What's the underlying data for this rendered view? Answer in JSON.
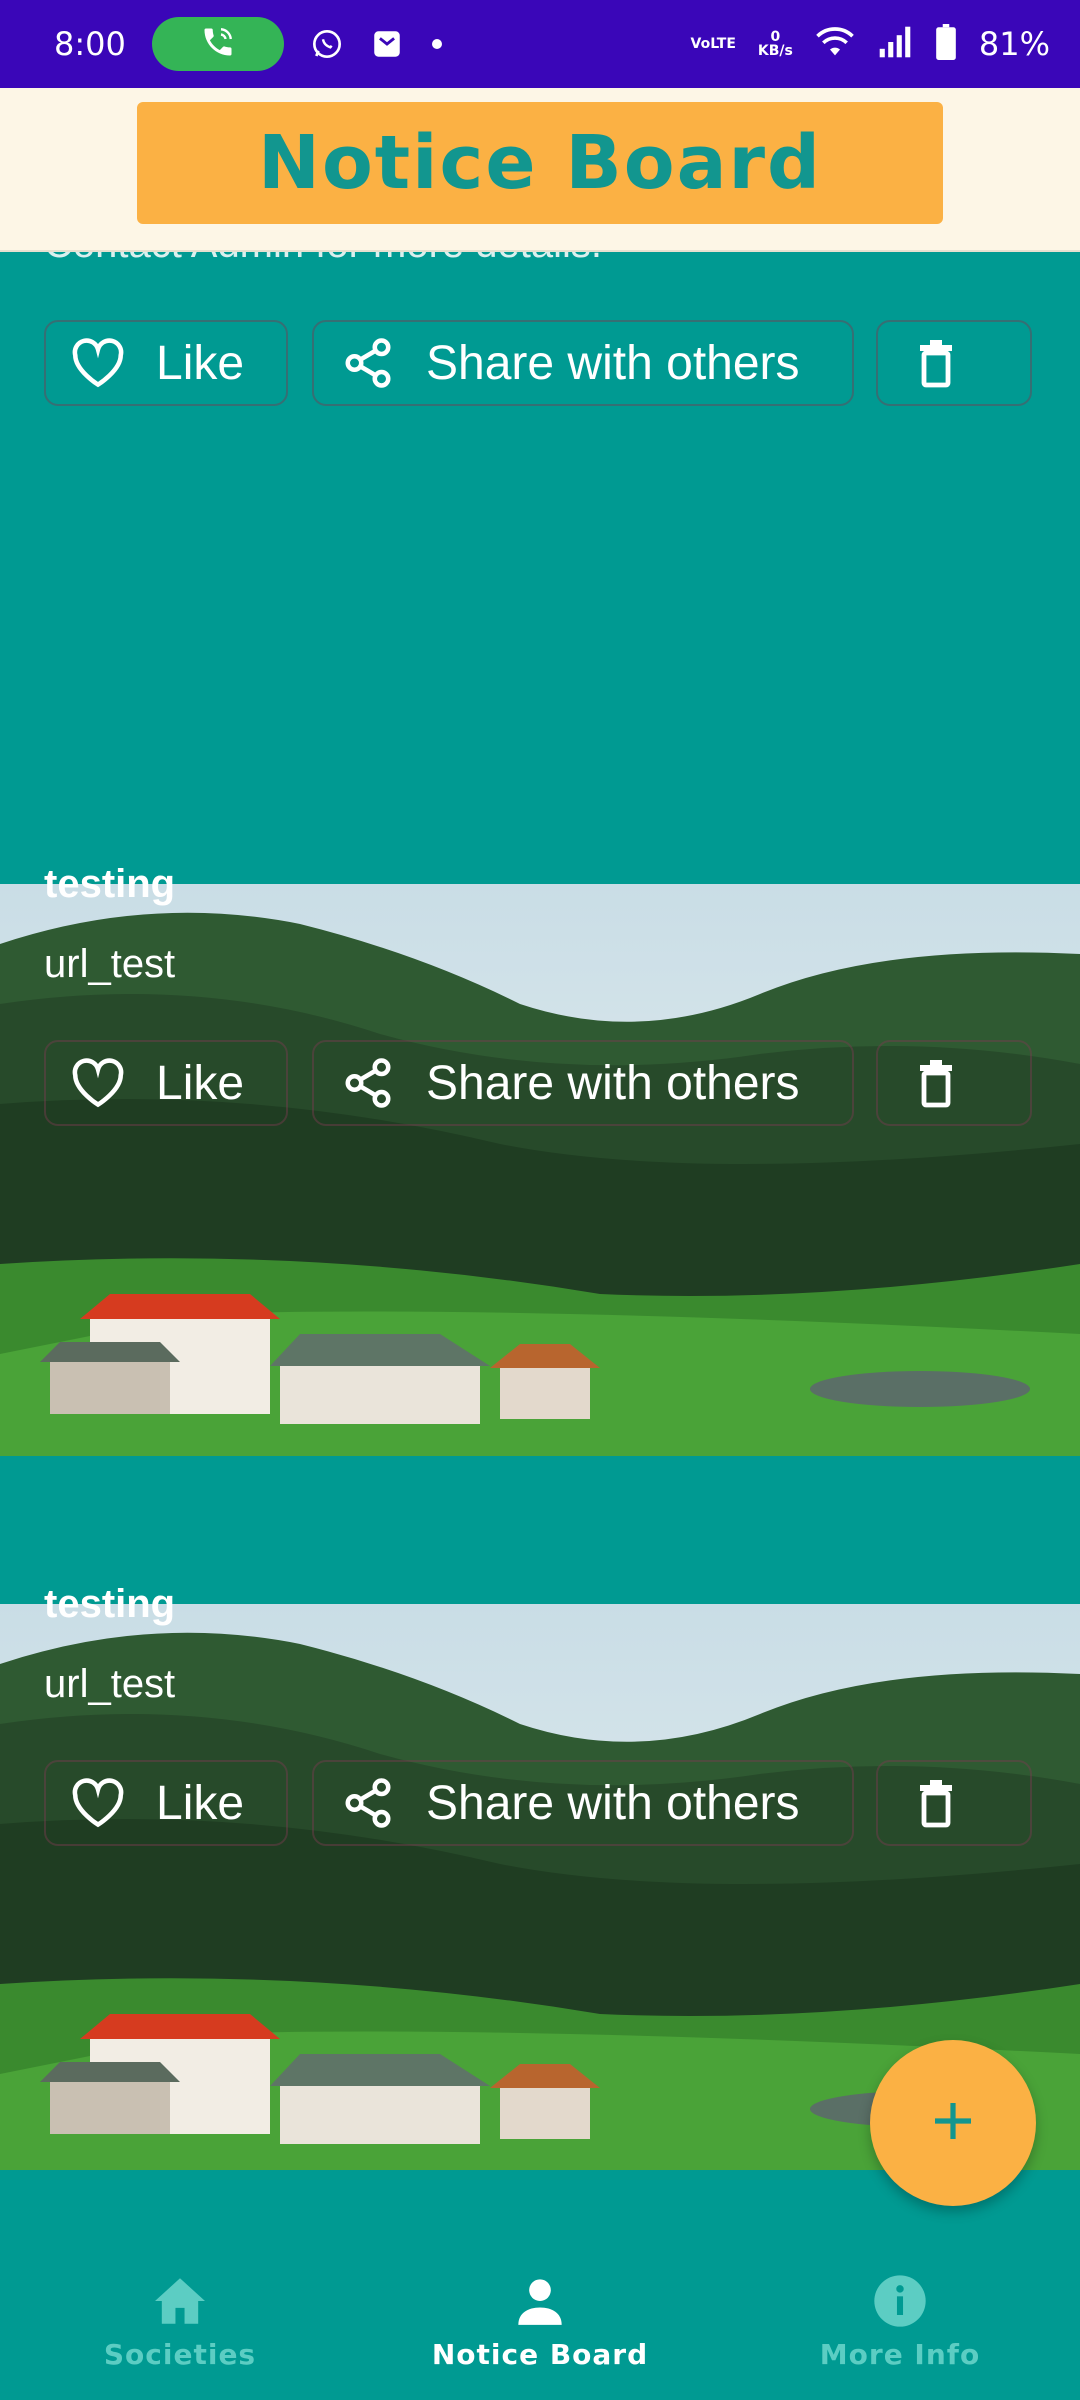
{
  "status_bar": {
    "time": "8:00",
    "network_label": "VoLTE",
    "data_speed_value": "0",
    "data_speed_unit": "KB/s",
    "battery": "81%",
    "icons": [
      "call-icon",
      "whatsapp-icon",
      "mail-icon",
      "wifi-icon",
      "signal-icon",
      "battery-icon"
    ]
  },
  "header": {
    "title": "Notice Board"
  },
  "feed": {
    "partial_text": "Contact Admin for more details.",
    "posts": [
      {
        "title": "testing",
        "body": "url_test"
      },
      {
        "title": "testing",
        "body": "url_test"
      }
    ]
  },
  "actions": {
    "like_label": "Like",
    "share_label": "Share with others"
  },
  "bottom_nav": {
    "items": [
      {
        "label": "Societies",
        "icon": "home-icon",
        "active": false
      },
      {
        "label": "Notice Board",
        "icon": "person-icon",
        "active": true
      },
      {
        "label": "More Info",
        "icon": "info-icon",
        "active": false
      }
    ]
  },
  "colors": {
    "status_bar": "#3a06b8",
    "background": "#009a92",
    "accent": "#fbb144",
    "header_bg": "#fdf6e6",
    "title_text": "#12968f"
  }
}
